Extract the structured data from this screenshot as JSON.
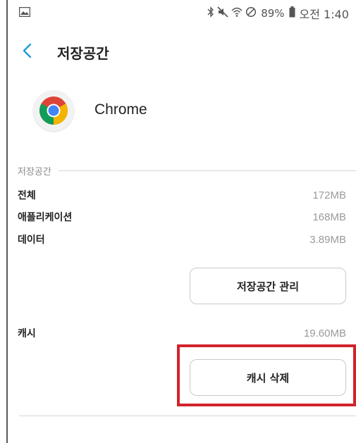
{
  "status_bar": {
    "battery_percent": "89%",
    "time": "오전 1:40"
  },
  "header": {
    "title": "저장공간"
  },
  "app": {
    "name": "Chrome",
    "icon": "chrome-icon"
  },
  "storage": {
    "section_label": "저장공간",
    "rows": [
      {
        "label": "전체",
        "value": "172MB"
      },
      {
        "label": "애플리케이션",
        "value": "168MB"
      },
      {
        "label": "데이터",
        "value": "3.89MB"
      }
    ],
    "manage_button_label": "저장공간 관리"
  },
  "cache": {
    "label": "캐시",
    "value": "19.60MB",
    "clear_button_label": "캐시 삭제"
  },
  "colors": {
    "highlight": "#d1232a",
    "back_arrow": "#1f9bd6"
  }
}
